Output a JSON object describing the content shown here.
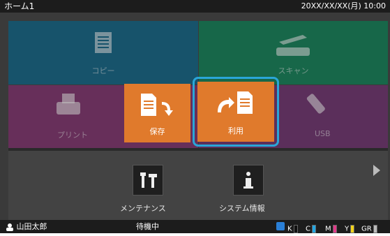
{
  "window": {
    "title": "ホーム1",
    "datetime": "20XX/XX/XX(月) 10:00"
  },
  "tiles": {
    "copy": {
      "label": "コピー",
      "color": "#1f6f8f"
    },
    "scan": {
      "label": "スキャン",
      "color": "#1f8a62"
    },
    "print": {
      "label": "プリント",
      "color": "#8a3f78"
    },
    "usb": {
      "label": "USB",
      "color": "#7a3f7a"
    },
    "save": {
      "label": "保存",
      "color": "#e07a2c"
    },
    "use": {
      "label": "利用",
      "color": "#e07a2c"
    }
  },
  "bottom": {
    "maintenance": {
      "label": "メンテナンス"
    },
    "system": {
      "label": "システム情報"
    }
  },
  "status": {
    "user": "山田太郎",
    "state": "待機中",
    "inks": [
      {
        "name": "K",
        "color": "#111111"
      },
      {
        "name": "C",
        "color": "#23a7e3"
      },
      {
        "name": "M",
        "color": "#e23a8a"
      },
      {
        "name": "Y",
        "color": "#f2d21b"
      },
      {
        "name": "GR",
        "color": "#bbbbbb"
      }
    ]
  }
}
